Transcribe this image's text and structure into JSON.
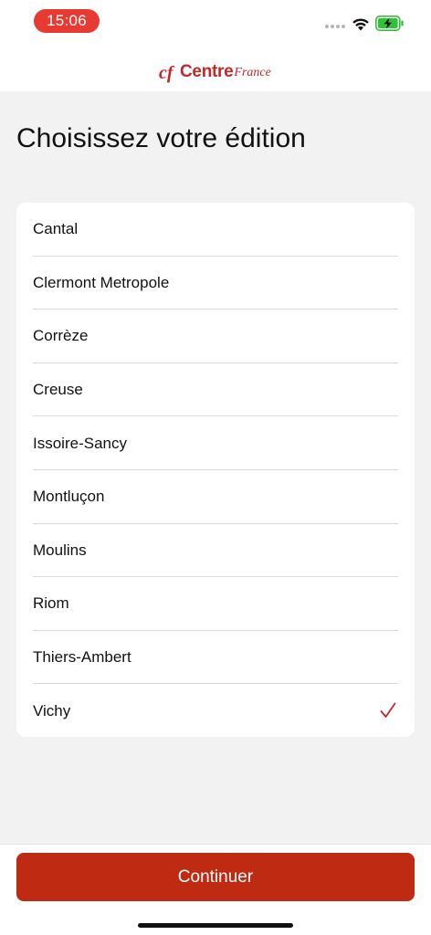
{
  "status_bar": {
    "time": "15:06",
    "wifi_icon": "wifi-icon",
    "battery_icon": "battery-charging-icon",
    "time_pill_color": "#e63a32",
    "battery_color": "#32c13b"
  },
  "header": {
    "logo_mark": "cf",
    "logo_centre": "Centre",
    "logo_france": "France",
    "brand_color": "#c0282a"
  },
  "page": {
    "title": "Choisissez votre édition"
  },
  "editions": {
    "items": [
      {
        "label": "Cantal",
        "selected": false
      },
      {
        "label": "Clermont Metropole",
        "selected": false
      },
      {
        "label": "Corrèze",
        "selected": false
      },
      {
        "label": "Creuse",
        "selected": false
      },
      {
        "label": "Issoire-Sancy",
        "selected": false
      },
      {
        "label": "Montluçon",
        "selected": false
      },
      {
        "label": "Moulins",
        "selected": false
      },
      {
        "label": "Riom",
        "selected": false
      },
      {
        "label": "Thiers-Ambert",
        "selected": false
      },
      {
        "label": "Vichy",
        "selected": true
      }
    ],
    "check_icon": "checkmark-icon",
    "check_color": "#c0282a"
  },
  "footer": {
    "continue_label": "Continuer",
    "button_color": "#bf2b12"
  }
}
